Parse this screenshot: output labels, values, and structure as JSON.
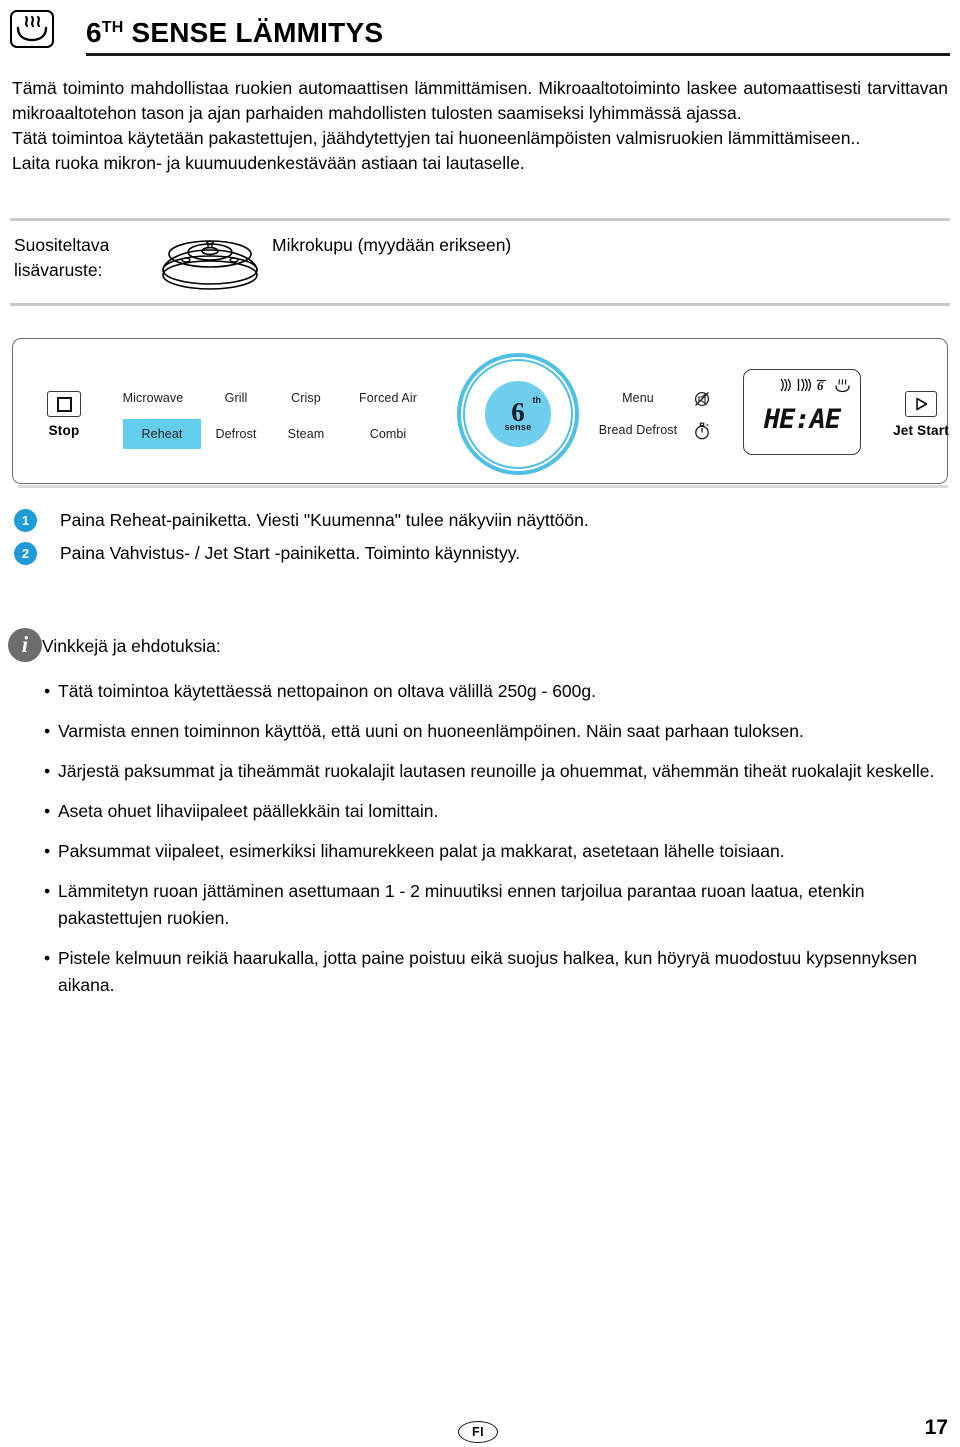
{
  "header": {
    "icon": "heat-dish-icon",
    "title_main": "6",
    "title_sup": "TH",
    "title_rest": " SENSE LÄMMITYS"
  },
  "intro": {
    "p1": "Tämä toiminto mahdollistaa ruokien automaattisen lämmittämisen. Mikroaaltotoiminto laskee automaattisesti tarvittavan mikroaaltotehon tason ja ajan parhaiden mahdollisten tulosten saamiseksi lyhimmässä ajassa.",
    "p2": "Tätä toimintoa käytetään pakastettujen, jäähdytettyjen tai huoneenlämpöisten valmisruokien lämmittämiseen..",
    "p3": "Laita ruoka mikron- ja kuumuudenkestävään astiaan tai lautaselle."
  },
  "accessory": {
    "label": "Suositeltava lisävaruste:",
    "image_name": "microwave-cover-illustration",
    "text": "Mikrokupu (myydään erikseen)"
  },
  "panel": {
    "stop": {
      "label": "Stop",
      "icon": "stop-square-icon"
    },
    "modes_row1": [
      "Microwave",
      "Grill",
      "Crisp",
      "Forced Air"
    ],
    "modes_row2": [
      "Reheat",
      "Defrost",
      "Steam",
      "Combi"
    ],
    "highlighted_mode": "Reheat",
    "highlight_color": "#63cdee",
    "knob": {
      "name": "6th-sense-knob",
      "six": "6",
      "th": "th",
      "sense": "sense",
      "color": "#6fcdee"
    },
    "menu_labels": [
      "Menu",
      "Bread Defrost"
    ],
    "menu_icons": [
      "mute-icon",
      "timer-icon"
    ],
    "display": {
      "value": "HE:AE",
      "indicators": [
        "microwave-waves-icon",
        "grill-waves-icon",
        "sixth-sense-icon",
        "heat-dish-icon"
      ]
    },
    "jet_start": {
      "label": "Jet Start",
      "icon": "play-triangle-icon"
    }
  },
  "steps": [
    {
      "num": "1",
      "text": "Paina Reheat-painiketta. Viesti \"Kuumenna\" tulee näkyviin näyttöön."
    },
    {
      "num": "2",
      "text": "Paina Vahvistus- / Jet Start -painiketta. Toiminto käynnistyy."
    }
  ],
  "tips": {
    "icon": "info-icon",
    "title": "Vinkkejä ja ehdotuksia:",
    "items": [
      "Tätä toimintoa käytettäessä nettopainon on oltava välillä 250g - 600g.",
      "Varmista ennen toiminnon käyttöä, että uuni on huoneenlämpöinen. Näin saat parhaan tuloksen.",
      "Järjestä paksummat ja tiheämmät ruokalajit lautasen reunoille ja ohuemmat, vähemmän tiheät ruokalajit keskelle.",
      "Aseta ohuet lihaviipaleet päällekkäin tai lomittain.",
      "Paksummat viipaleet, esimerkiksi lihamurekkeen palat ja makkarat, asetetaan lähelle toisiaan.",
      "Lämmitetyn ruoan jättäminen asettumaan 1 - 2 minuutiksi ennen tarjoilua parantaa ruoan laatua, etenkin pakastettujen ruokien.",
      "Pistele kelmuun reikiä haarukalla, jotta paine poistuu eikä suojus halkea, kun höyryä muodostuu kypsennyksen aikana."
    ]
  },
  "footer": {
    "language_badge": "FI",
    "page_number": "17"
  }
}
